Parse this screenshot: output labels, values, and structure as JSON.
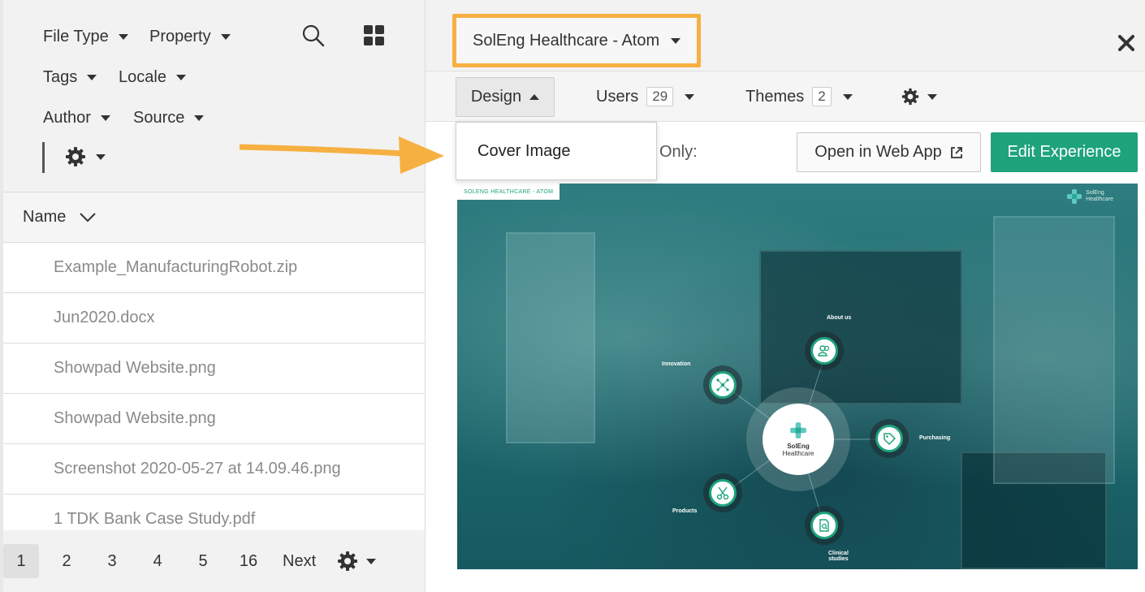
{
  "filters": {
    "file_type": "File Type",
    "property": "Property",
    "tags": "Tags",
    "locale": "Locale",
    "author": "Author",
    "source": "Source"
  },
  "list": {
    "sort_label": "Name",
    "files": [
      "Example_ManufacturingRobot.zip",
      "Jun2020.docx",
      "Showpad Website.png",
      "Showpad Website.png",
      "Screenshot 2020-05-27 at 14.09.46.png",
      "1 TDK Bank Case Study.pdf"
    ]
  },
  "pager": {
    "pages": [
      "1",
      "2",
      "3",
      "4",
      "5",
      "16"
    ],
    "active": "1",
    "next_label": "Next"
  },
  "experience": {
    "selected": "SolEng Healthcare - Atom",
    "highlight_color": "#f6b042"
  },
  "tabs": {
    "design": "Design",
    "users": "Users",
    "users_count": "29",
    "themes": "Themes",
    "themes_count": "2"
  },
  "design_menu": {
    "items": [
      "Cover Image"
    ]
  },
  "toolbar": {
    "filter_label": "Only:",
    "open_web_app": "Open in Web App",
    "edit_experience": "Edit Experience",
    "accent_color": "#1ea37c"
  },
  "cover": {
    "tag": "SOLENG HEALTHCARE - ATOM",
    "logo_line1": "SolEng",
    "logo_line2": "Healthcare",
    "hub_title": "SolEng",
    "hub_subtitle": "Healthcare",
    "nodes": {
      "about": "About us",
      "innovation": "Innovation",
      "purchasing": "Purchasing",
      "products": "Products",
      "clinical_1": "Clinical",
      "clinical_2": "studies"
    }
  }
}
